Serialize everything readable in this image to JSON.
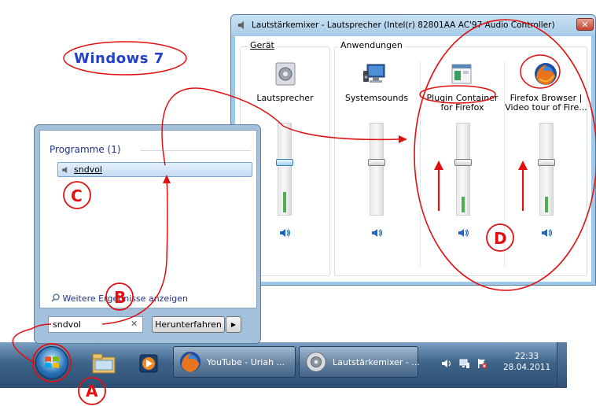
{
  "annotation": {
    "heading": "Windows 7",
    "letters": {
      "a": "A",
      "b": "B",
      "c": "C",
      "d": "D"
    },
    "color": "#e01010"
  },
  "mixer": {
    "title": "Lautstärkemixer - Lautsprecher (Intel(r) 82801AA AC'97 Audio Controller)",
    "close_label": "✕",
    "device_group": "Gerät",
    "apps_group": "Anwendungen",
    "channels": [
      {
        "name": "Lautsprecher",
        "icon": "speaker-device-icon",
        "level": 0.5,
        "peak": 0.3
      },
      {
        "name": "Systemsounds",
        "icon": "system-sounds-icon",
        "level": 0.5,
        "peak": 0
      },
      {
        "name": "Plugin Container for Firefox",
        "line1": "Plugin Container",
        "line2": "for Firefox",
        "icon": "plugin-container-icon",
        "level": 0.5,
        "peak": 0.2
      },
      {
        "name": "Firefox Browser | Video tour of Fire...",
        "line1": "Firefox Browser |",
        "line2": "Video tour of Fire...",
        "icon": "firefox-icon",
        "level": 0.5,
        "peak": 0.2
      }
    ]
  },
  "startmenu": {
    "programs_heading": "Programme (1)",
    "result_label": "sndvol",
    "more_results": "Weitere Ergebnisse anzeigen",
    "search_value": "sndvol",
    "clear_label": "✕",
    "shutdown_label": "Herunterfahren",
    "shutdown_arrow": "▶"
  },
  "taskbar": {
    "buttons": [
      {
        "label": "YouTube - Uriah ...",
        "icon": "firefox-icon"
      },
      {
        "label": "Lautstärkemixer - ...",
        "icon": "speaker-icon"
      }
    ],
    "time": "22:33",
    "date": "28.04.2011"
  }
}
